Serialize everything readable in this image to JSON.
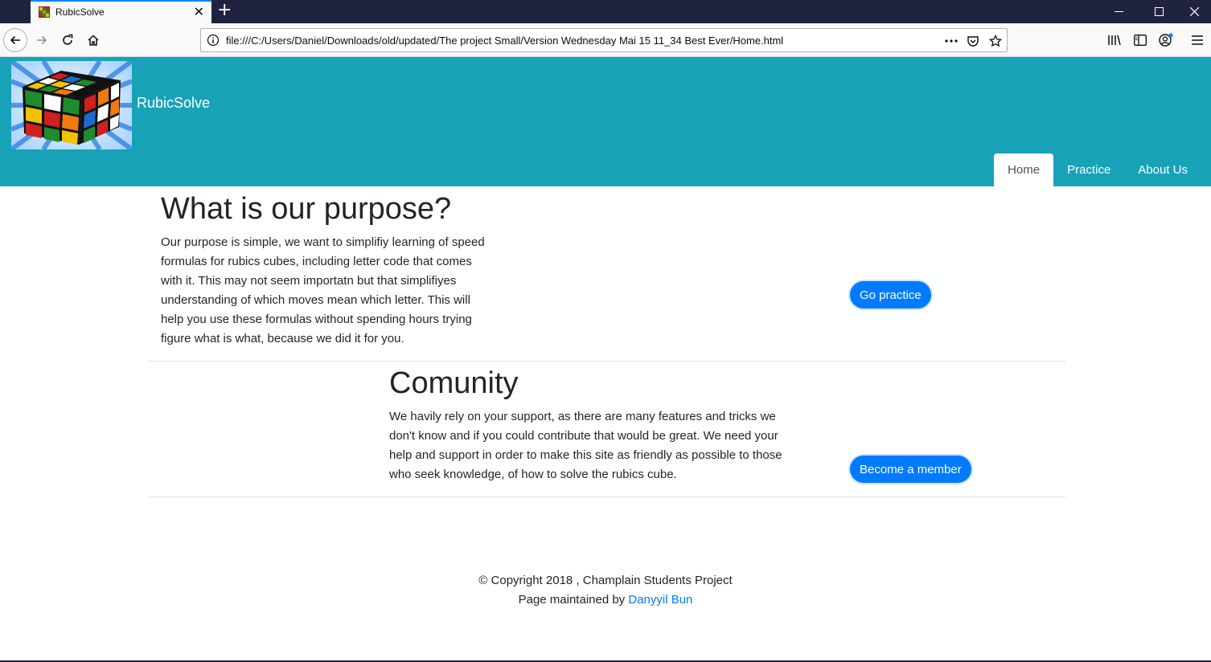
{
  "browser": {
    "tab_title": "RubicSolve",
    "url": "file:///C:/Users/Daniel/Downloads/old/updated/The project Small/Version Wednesday Mai 15 11_34 Best Ever/Home.html",
    "icons": [
      "back-icon",
      "forward-icon",
      "reload-icon",
      "home-icon",
      "info-icon",
      "more-icon",
      "pocket-icon",
      "bookmark-star-icon",
      "library-icon",
      "sidebar-icon",
      "account-icon",
      "menu-icon"
    ]
  },
  "site": {
    "brand": "RubicSolve",
    "nav": [
      {
        "label": "Home",
        "active": true
      },
      {
        "label": "Practice",
        "active": false
      },
      {
        "label": "About Us",
        "active": false
      }
    ]
  },
  "purpose": {
    "title": "What is our purpose?",
    "lines": [
      "Our purpose is simple, we want to simplifiy learning of speed",
      "formulas for rubics cubes, including letter code that comes",
      "with it. This may not seem importatn but that simplifiyes",
      "understanding of which moves mean which letter. This will",
      "help you use these formulas without spending hours trying",
      "figure what is what, because we did it for you."
    ],
    "button": "Go practice"
  },
  "community": {
    "title": "Comunity",
    "lines": [
      "We havily rely on your support, as there are many features and tricks we",
      "don't know and if you could contribute that would be great. We need your",
      "help and support in order to make this site as friendly as possible to those",
      "who seek knowledge, of how to solve the rubics cube."
    ],
    "button": "Become a member"
  },
  "footer": {
    "copyright": "© Copyright 2018 , Champlain Students Project",
    "maintained_prefix": "Page maintained by ",
    "maintainer": "Danyyil Bun"
  },
  "colors": {
    "header_bg": "#17a2b8",
    "button_bg": "#007bff",
    "chrome_dark": "#202340"
  }
}
